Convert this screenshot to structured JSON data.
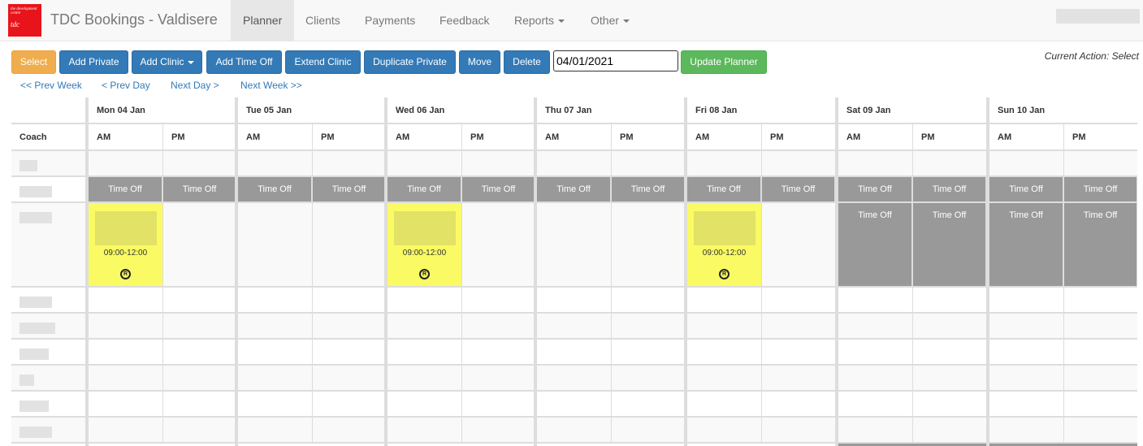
{
  "navbar": {
    "brand": "TDC Bookings - Valdisere",
    "logo_text_small": "the development centre",
    "logo_text_big": "tdc",
    "items": [
      {
        "label": "Planner",
        "active": true
      },
      {
        "label": "Clients"
      },
      {
        "label": "Payments"
      },
      {
        "label": "Feedback"
      },
      {
        "label": "Reports",
        "dropdown": true
      },
      {
        "label": "Other",
        "dropdown": true
      }
    ]
  },
  "toolbar": {
    "select": "Select",
    "add_private": "Add Private",
    "add_clinic": "Add Clinic",
    "add_time_off": "Add Time Off",
    "extend_clinic": "Extend Clinic",
    "duplicate_private": "Duplicate Private",
    "move": "Move",
    "delete": "Delete",
    "date_value": "04/01/2021",
    "update_planner": "Update Planner",
    "current_action": "Current Action: Select"
  },
  "navigation": {
    "prev_week": "<< Prev Week",
    "prev_day": "< Prev Day",
    "next_day": "Next Day >",
    "next_week": "Next Week >>"
  },
  "planner": {
    "coach_header": "Coach",
    "am": "AM",
    "pm": "PM",
    "time_off": "Time Off",
    "days": [
      "Mon 04 Jan",
      "Tue 05 Jan",
      "Wed 06 Jan",
      "Thu 07 Jan",
      "Fri 08 Jan",
      "Sat 09 Jan",
      "Sun 10 Jan"
    ],
    "bookings": [
      {
        "day": 0,
        "slot": "AM",
        "time": "09:00-12:00",
        "badge": "R"
      },
      {
        "day": 2,
        "slot": "AM",
        "time": "09:00-12:00",
        "badge": "R"
      },
      {
        "day": 4,
        "slot": "AM",
        "time": "09:00-12:00",
        "badge": "R"
      }
    ],
    "colors": {
      "booking": "#fafa64",
      "time_off": "#999999",
      "select_button": "#f0ad4e",
      "primary_button": "#337ab7",
      "success_button": "#5cb85c"
    }
  }
}
